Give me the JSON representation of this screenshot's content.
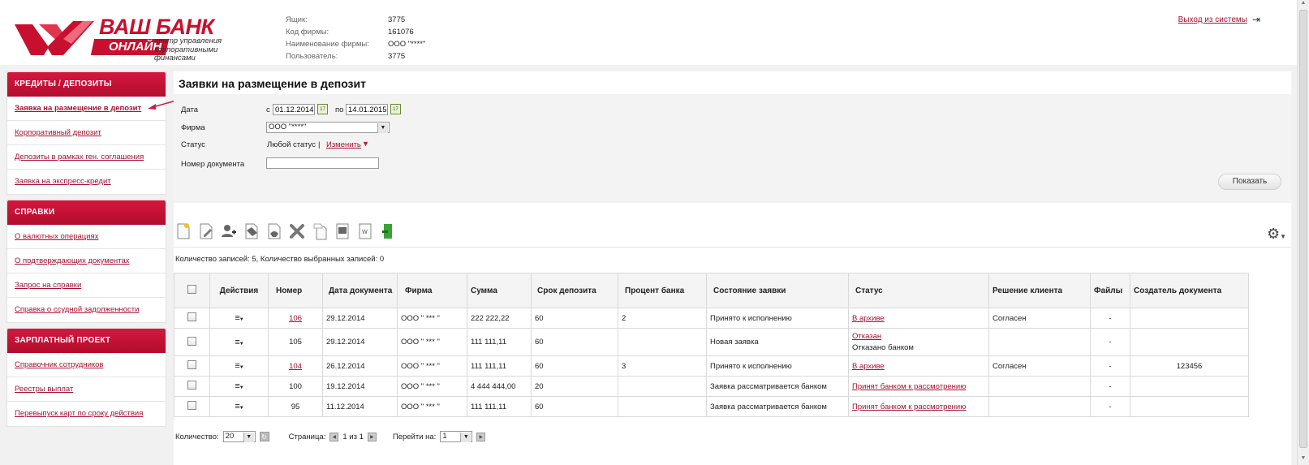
{
  "brand": {
    "name": "ВАШ БАНК",
    "badge": "ОНЛАЙН",
    "subtitle_l1": "центр управления",
    "subtitle_l2": "корпоративными",
    "subtitle_l3": "финансами",
    "color": "#c8102e"
  },
  "account_info": [
    {
      "label": "Ящик:",
      "value": "3775"
    },
    {
      "label": "Код фирмы:",
      "value": "161076"
    },
    {
      "label": "Наименование фирмы:",
      "value": "ООО \"****\""
    },
    {
      "label": "Пользователь:",
      "value": "3775"
    }
  ],
  "logout": {
    "label": "Выход из системы",
    "icon": "logout-icon"
  },
  "sidebar": {
    "sections": [
      {
        "title": "КРЕДИТЫ / ДЕПОЗИТЫ",
        "items": [
          {
            "label": "Заявка на размещение в депозит",
            "active": true
          },
          {
            "label": "Корпоративный депозит"
          },
          {
            "label": "Депозиты в рамках ген. соглашения"
          },
          {
            "label": "Заявка на экспресс-кредит"
          }
        ]
      },
      {
        "title": "СПРАВКИ",
        "items": [
          {
            "label": "О валютных операциях"
          },
          {
            "label": "О подтверждающих документах"
          },
          {
            "label": "Запрос на справки"
          },
          {
            "label": "Справка о ссудной задолженности"
          }
        ]
      },
      {
        "title": "ЗАРПЛАТНЫЙ ПРОЕКТ",
        "items": [
          {
            "label": "Справочник сотрудников"
          },
          {
            "label": "Реестры выплат"
          },
          {
            "label": "Перевыпуск карт по сроку действия"
          }
        ]
      }
    ]
  },
  "main": {
    "title": "Заявки на размещение в депозит",
    "filter": {
      "date_label": "Дата",
      "from_prefix": "с",
      "from_value": "01.12.2014",
      "to_prefix": "по",
      "to_value": "14.01.2015",
      "firm_label": "Фирма",
      "firm_value": "ООО \"****\"",
      "status_label": "Статус",
      "status_value": "Любой статус",
      "status_sep": "|",
      "status_change": "Изменить",
      "docnum_label": "Номер документа",
      "docnum_value": "",
      "show_button": "Показать"
    },
    "toolbar_icons": [
      "new-doc-icon",
      "edit-doc-icon",
      "add-user-icon",
      "sign-icon",
      "send-icon",
      "delete-icon",
      "copy-icon",
      "print-icon",
      "export-icon",
      "exit-icon"
    ],
    "count_text": "Количество записей: 5, Количество выбранных записей: 0",
    "table": {
      "headers": [
        "Действия",
        "Номер",
        "Дата документа",
        "Фирма",
        "Сумма",
        "Срок депозита",
        "Процент банка",
        "Состояние заявки",
        "Статус",
        "Решение клиента",
        "Файлы",
        "Создатель документа"
      ],
      "rows": [
        {
          "number": "106",
          "number_link": true,
          "date": "29.12.2014",
          "firm": "ООО \" *** \"",
          "sum": "222 222,22",
          "term": "60",
          "percent": "2",
          "state": "Принято к исполнению",
          "status": "В архиве",
          "status2": "",
          "decision": "Согласен",
          "files": "-",
          "creator": ""
        },
        {
          "number": "105",
          "number_link": false,
          "date": "29.12.2014",
          "firm": "ООО \" *** \"",
          "sum": "111 111,11",
          "term": "60",
          "percent": "",
          "state": "Новая заявка",
          "status": "Отказан",
          "status2": "Отказано банком",
          "decision": "",
          "files": "-",
          "creator": ""
        },
        {
          "number": "104",
          "number_link": true,
          "date": "26.12.2014",
          "firm": "ООО \" *** \"",
          "sum": "111 111,11",
          "term": "60",
          "percent": "3",
          "state": "Принято к исполнению",
          "status": "В архиве",
          "status2": "",
          "decision": "Согласен",
          "files": "-",
          "creator": "123456"
        },
        {
          "number": "100",
          "number_link": false,
          "date": "19.12.2014",
          "firm": "ООО \" *** \"",
          "sum": "4 444 444,00",
          "term": "20",
          "percent": "",
          "state": "Заявка рассматривается банком",
          "status": "Принят банком к рассмотрению",
          "status2": "",
          "decision": "",
          "files": "-",
          "creator": ""
        },
        {
          "number": "95",
          "number_link": false,
          "date": "11.12.2014",
          "firm": "ООО \" *** \"",
          "sum": "111 111,11",
          "term": "60",
          "percent": "",
          "state": "Заявка рассматривается банком",
          "status": "Принят банком к рассмотрению",
          "status2": "",
          "decision": "",
          "files": "-",
          "creator": ""
        }
      ]
    },
    "pager": {
      "qty_label": "Количество:",
      "qty_value": "20",
      "page_label": "Страница:",
      "page_text": "1 из 1",
      "goto_label": "Перейти на:",
      "goto_value": "1"
    }
  }
}
